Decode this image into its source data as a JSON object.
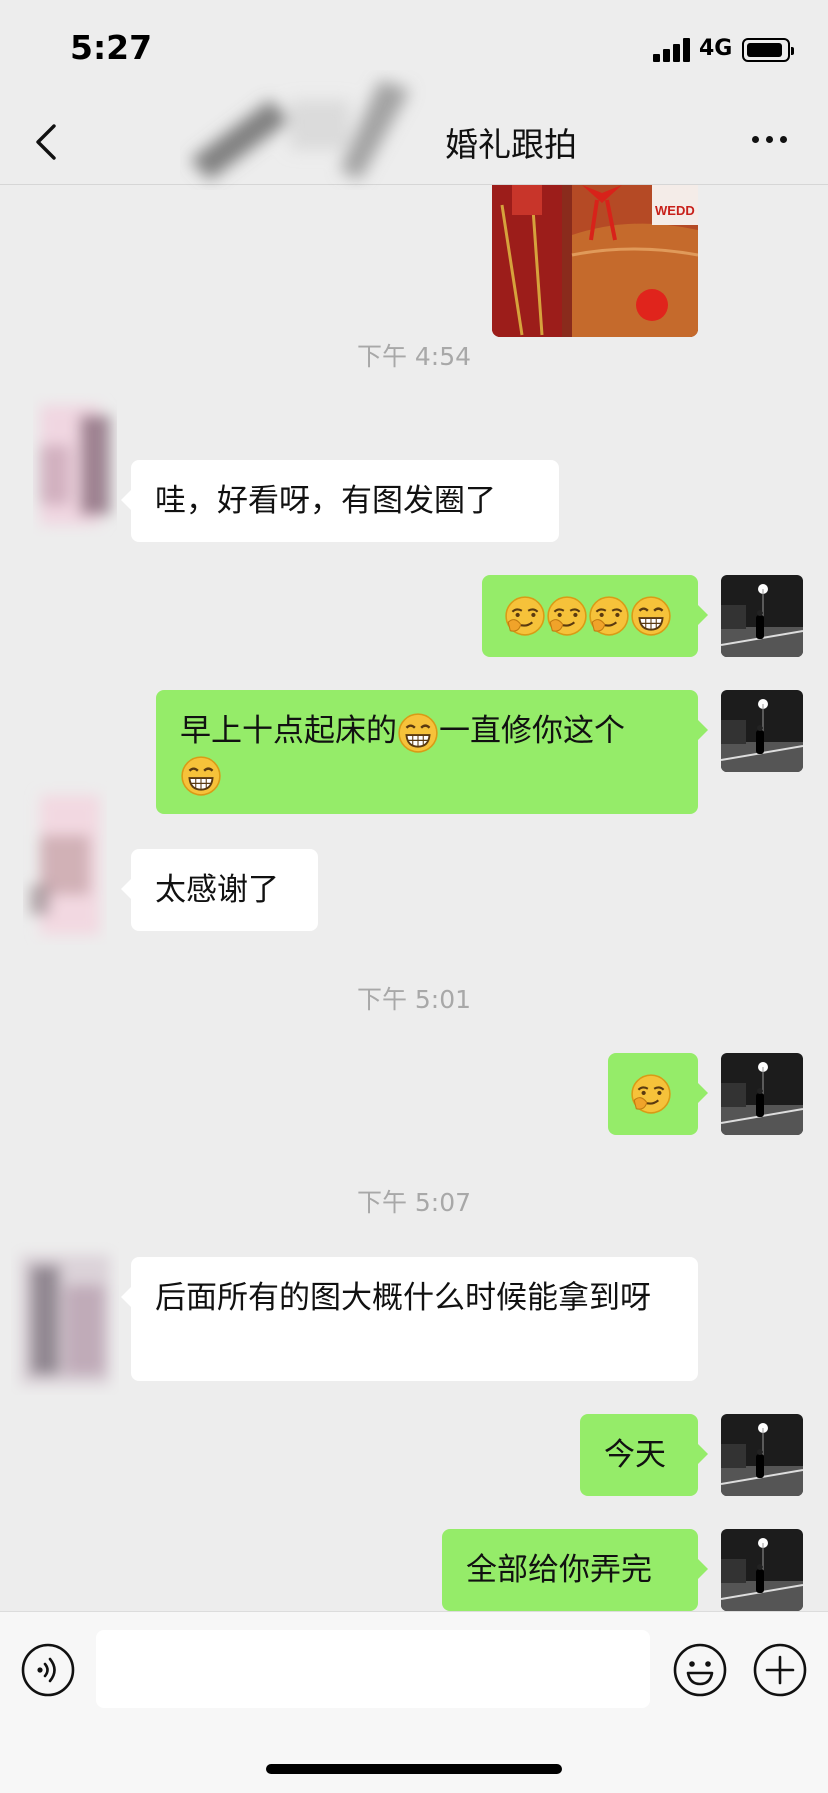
{
  "status_bar": {
    "time": "5:27",
    "network": "4G"
  },
  "header": {
    "title": "婚礼跟拍",
    "back_icon": "chevron-left-icon",
    "more_icon": "more-dots-icon"
  },
  "messages": {
    "ts1": "下午 4:54",
    "m1": "哇，好看呀，有图发圈了",
    "m3a": "早上十点起床的",
    "m3b": "一直修你这个",
    "m4": "太感谢了",
    "ts2": "下午 5:01",
    "ts3": "下午 5:07",
    "m6": "后面所有的图大概什么时候能拿到呀",
    "m7": "今天",
    "m8": "全部给你弄完"
  },
  "photo": {
    "text": "WEDD"
  },
  "input_bar": {
    "placeholder": ""
  },
  "colors": {
    "background": "#ededed",
    "out_bubble": "#95ec69",
    "in_bubble": "#ffffff",
    "timestamp": "#a8a8a8"
  }
}
